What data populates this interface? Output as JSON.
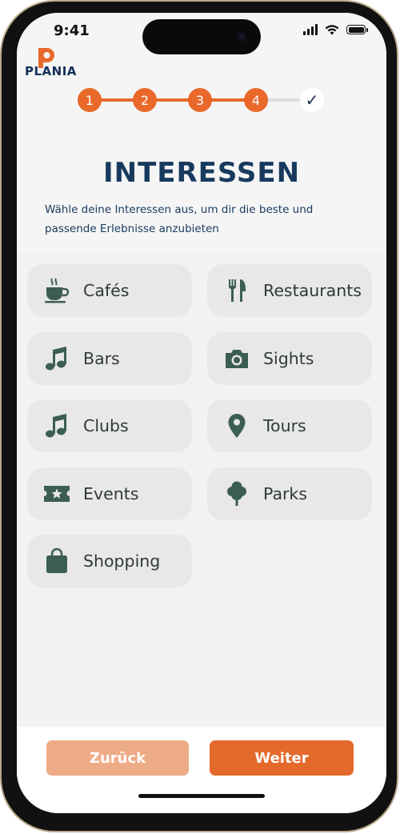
{
  "status_bar": {
    "time": "9:41"
  },
  "brand": {
    "name": "PLANIA",
    "accent": "#e8692a",
    "text_color": "#12305a"
  },
  "stepper": {
    "steps": [
      {
        "label": "1",
        "state": "complete"
      },
      {
        "label": "2",
        "state": "complete"
      },
      {
        "label": "3",
        "state": "complete"
      },
      {
        "label": "4",
        "state": "current"
      },
      {
        "label": "✓",
        "state": "final"
      }
    ],
    "active_color": "#e8692a",
    "inactive_color": "#dddddd"
  },
  "page": {
    "title": "INTERESSEN",
    "subtitle": "Wähle deine Interessen aus, um dir die beste und passende Erlebnisse anzubieten"
  },
  "interests": [
    {
      "label": "Cafés",
      "icon": "coffee-icon"
    },
    {
      "label": "Restaurants",
      "icon": "fork-knife-icon"
    },
    {
      "label": "Bars",
      "icon": "music-note-icon"
    },
    {
      "label": "Sights",
      "icon": "camera-icon"
    },
    {
      "label": "Clubs",
      "icon": "music-note-icon"
    },
    {
      "label": "Tours",
      "icon": "map-pin-icon"
    },
    {
      "label": "Events",
      "icon": "ticket-icon"
    },
    {
      "label": "Parks",
      "icon": "tree-icon"
    },
    {
      "label": "Shopping",
      "icon": "shopping-bag-icon"
    }
  ],
  "buttons": {
    "back": "Zurück",
    "next": "Weiter"
  },
  "colors": {
    "icon": "#3b5d54",
    "title": "#173a5e",
    "next_button": "#e46a2c",
    "back_button": "#eeab87"
  }
}
